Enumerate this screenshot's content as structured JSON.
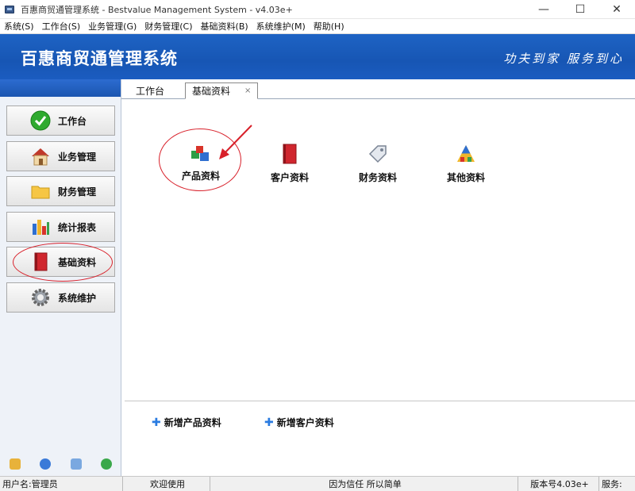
{
  "window": {
    "title": "百惠商贸通管理系统 - Bestvalue Management System - v4.03e+",
    "controls": [
      "—",
      "☐",
      "✕"
    ]
  },
  "menubar": {
    "items": [
      "系统(S)",
      "工作台(S)",
      "业务管理(G)",
      "财务管理(C)",
      "基础资料(B)",
      "系统维护(M)",
      "帮助(H)"
    ]
  },
  "banner": {
    "title": "百惠商贸通管理系统",
    "slogan": "功夫到家 服务到心"
  },
  "sidebar": {
    "items": [
      {
        "label": "工作台",
        "icon": "check-icon"
      },
      {
        "label": "业务管理",
        "icon": "house-icon"
      },
      {
        "label": "财务管理",
        "icon": "folder-icon"
      },
      {
        "label": "统计报表",
        "icon": "bar-chart-icon"
      },
      {
        "label": "基础资料",
        "icon": "book-icon"
      },
      {
        "label": "系统维护",
        "icon": "gear-icon"
      }
    ],
    "footer_icons": [
      "key-icon",
      "clock-icon",
      "search-window-icon",
      "back-arrow-icon"
    ]
  },
  "tabs": {
    "items": [
      "工作台",
      "基础资料"
    ],
    "close": "×"
  },
  "modules": {
    "items": [
      {
        "label": "产品资料",
        "icon": "product-cubes-icon"
      },
      {
        "label": "客户资料",
        "icon": "red-book-icon"
      },
      {
        "label": "财务资料",
        "icon": "price-tag-icon"
      },
      {
        "label": "其他资料",
        "icon": "color-palette-icon"
      }
    ]
  },
  "quick_actions": {
    "plus": "✚",
    "items": [
      "新增产品资料",
      "新增客户资料"
    ]
  },
  "statusbar": {
    "user": "用户名:管理员",
    "welcome": "欢迎使用",
    "motto": "因为信任 所以简单",
    "version": "版本号4.03e+",
    "service": "服务:"
  },
  "colors": {
    "banner": "#1b5cc0",
    "annotation": "#d8202a",
    "plus": "#2a7be0"
  }
}
